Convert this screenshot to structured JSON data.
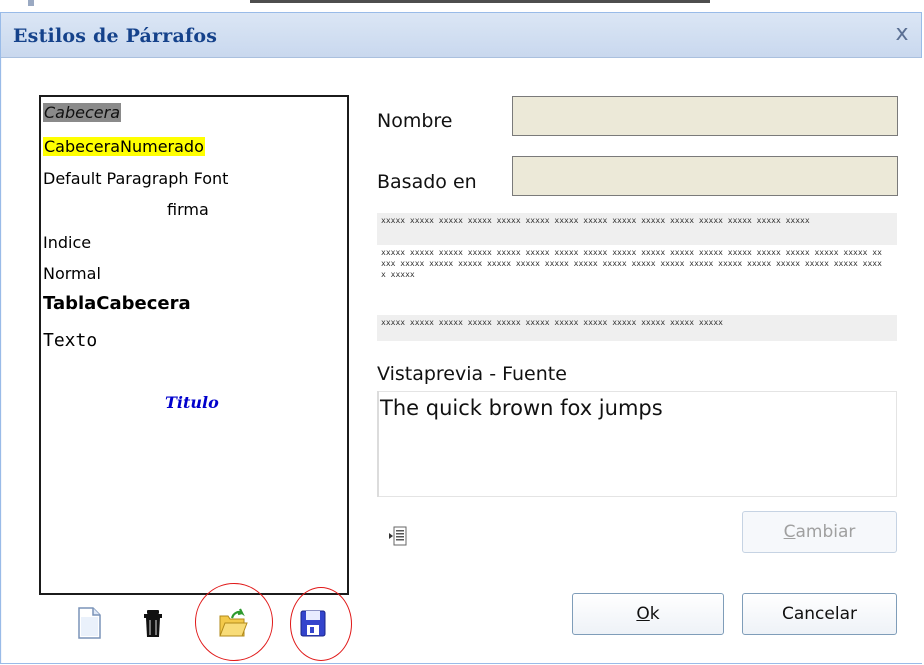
{
  "dialog": {
    "title": "Estilos de Párrafos",
    "close_label": "x"
  },
  "styles": {
    "items": [
      {
        "label": "Cabecera",
        "state": "selected"
      },
      {
        "label": "CabeceraNumerado",
        "highlight": "#ffff00"
      },
      {
        "label": "Default Paragraph Font"
      },
      {
        "label": "firma"
      },
      {
        "label": "Indice"
      },
      {
        "label": "Normal"
      },
      {
        "label": "TablaCabecera"
      },
      {
        "label": "Texto"
      },
      {
        "label": "Titulo",
        "color": "#0000cc"
      }
    ]
  },
  "toolbar": {
    "icons": [
      "new-document-icon",
      "trash-icon",
      "open-folder-icon",
      "save-disk-icon"
    ]
  },
  "form": {
    "name_label": "Nombre",
    "name_value": "",
    "based_on_label": "Basado en",
    "based_on_value": ""
  },
  "sample": {
    "line1": "xxxxx xxxxx xxxxx xxxxx xxxxx xxxxx xxxxx xxxxx xxxxx xxxxx xxxxx xxxxx xxxxx xxxxx xxxxx",
    "line2": "xxxxx xxxxx xxxxx xxxxx xxxxx xxxxx xxxxx xxxxx xxxxx xxxxx xxxxx xxxxx xxxxx xxxxx xxxxx xxxxx xxxxx xxxxx xxxxx xxxxx xxxxx xxxxx xxxxx xxxxx xxxxx xxxxx xxxxx xxxxx xxxxx xxxxx xxxxx xxxxx xxxxx xxxxx xxxxx xxxxx",
    "line3": "xxxxx xxxxx xxxxx xxxxx xxxxx xxxxx xxxxx xxxxx xxxxx xxxxx xxxxx xxxxx"
  },
  "preview": {
    "label": "Vistaprevia - Fuente",
    "text": "The quick brown fox jumps"
  },
  "buttons": {
    "change": {
      "prefix": "",
      "mnemonic": "C",
      "rest": "ambiar"
    },
    "ok": {
      "mnemonic": "O",
      "rest": "k"
    },
    "cancel": "Cancelar"
  },
  "colors": {
    "title": "#15428b",
    "highlight": "#ffff00",
    "selection": "#8a8a8a",
    "field_bg": "#ece9d8",
    "annotation": "#e01818"
  }
}
